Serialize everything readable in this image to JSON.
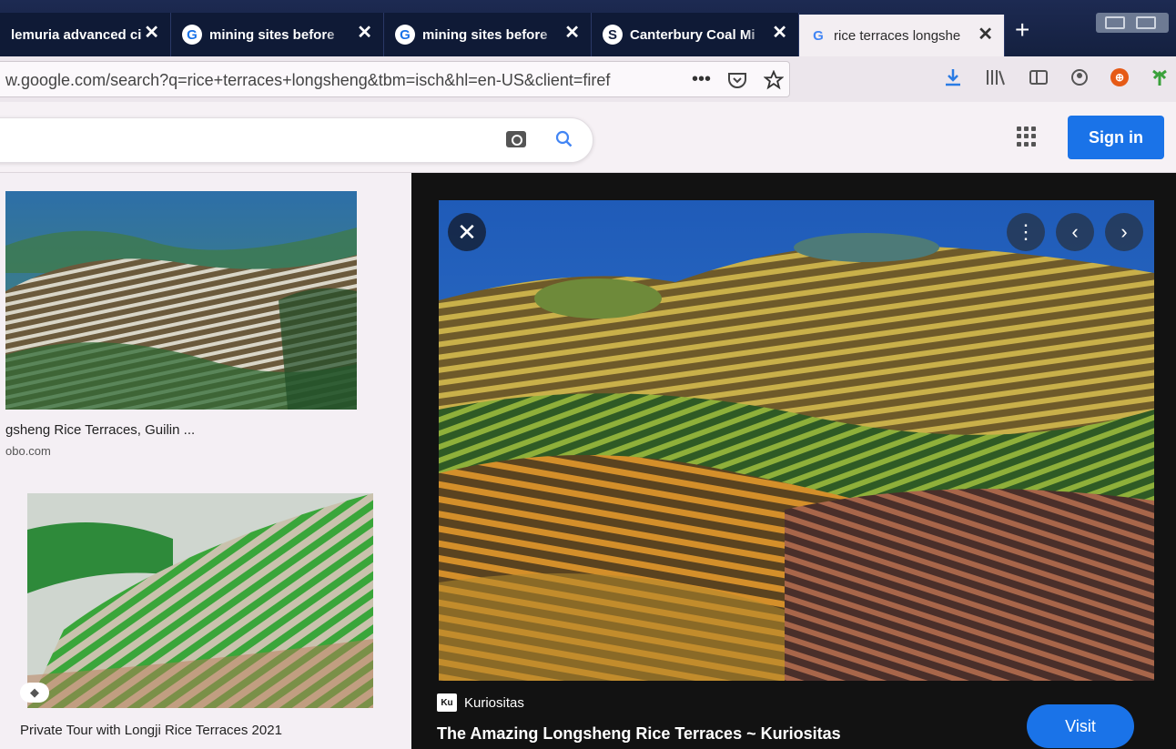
{
  "browser": {
    "tabs": [
      {
        "title": "lemuria advanced ci",
        "favicon": "",
        "active": false
      },
      {
        "title": "mining sites before",
        "favicon": "G",
        "active": false
      },
      {
        "title": "mining sites before",
        "favicon": "G",
        "active": false
      },
      {
        "title": "Canterbury Coal Mi",
        "favicon": "S",
        "active": false
      },
      {
        "title": "rice terraces longshe",
        "favicon": "G",
        "active": true
      }
    ],
    "close_glyph": "✕",
    "new_tab_glyph": "+",
    "url": "w.google.com/search?q=rice+terraces+longsheng&tbm=isch&hl=en-US&client=firef",
    "url_more": "•••",
    "toolbar_icons": [
      "download-icon",
      "library-icon",
      "sidebar-icon",
      "account-icon",
      "ublock-icon",
      "extension-icon"
    ]
  },
  "google": {
    "signin_label": "Sign in"
  },
  "results": [
    {
      "title": "gsheng Rice Terraces, Guilin ...",
      "source": "obo.com"
    },
    {
      "title": "Private Tour with Longji Rice Terraces 2021",
      "source": ""
    }
  ],
  "preview": {
    "source_icon_text": "Ku",
    "source_name": "Kuriositas",
    "title": "The Amazing Longsheng Rice Terraces ~ Kuriositas",
    "visit_label": "Visit",
    "close_glyph": "✕"
  },
  "colors": {
    "accent": "#1a73e8",
    "tabstrip": "#14203f",
    "preview_bg": "#121212"
  }
}
